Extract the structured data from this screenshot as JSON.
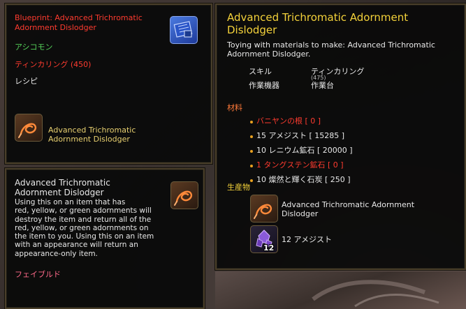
{
  "blueprint_panel": {
    "title_line1": "Blueprint: Advanced Trichromatic",
    "title_line2": "Adornment Dislodger",
    "job": "アシコモン",
    "skill": "ティンカリング (450)",
    "type": "レシピ",
    "result_line1": "Advanced Trichromatic",
    "result_line2": "Adornment Dislodger"
  },
  "item_panel": {
    "name_line1": "Advanced Trichromatic",
    "name_line2": "Adornment Dislodger",
    "description_lines": [
      "Using this on an item that has",
      "red, yellow, or green adornments will",
      "destroy the item and return all of the",
      "red, yellow, or green adornments on",
      "the item to you.  Using this on an item",
      " with an appearance will return an",
      "appearance-only item."
    ],
    "flag": "フェイブルド"
  },
  "recipe_panel": {
    "title_line1": "Advanced Trichromatic Adornment",
    "title_line2": "Dislodger",
    "subtitle_line1": "Toying with materials to make: Advanced Trichromatic",
    "subtitle_line2": "Adornment Dislodger.",
    "skill_label": "スキル",
    "skill_value": "ティンカリング",
    "skill_level": "(475)",
    "device_label": "作業機器",
    "device_value": "作業台",
    "materials_heading": "材料",
    "materials": [
      {
        "text": "バニヤンの根 [ 0 ]",
        "missing": true
      },
      {
        "text": "15 アメジスト [ 15285 ]",
        "missing": false
      },
      {
        "text": "10 レニウム鉱石 [ 20000 ]",
        "missing": false
      },
      {
        "text": "1 タングステン鉱石 [ 0 ]",
        "missing": true
      },
      {
        "text": "10 燦然と輝く石炭 [ 250 ]",
        "missing": false
      }
    ],
    "products_heading": "生産物",
    "product1_line1": "Advanced Trichromatic Adornment",
    "product1_line2": "Dislodger",
    "product2": "12 アメジスト",
    "product2_count": "12"
  },
  "colors": {
    "title_red": "#ff3b2f",
    "job_green": "#56d35a",
    "heading_gold": "#f4d23a",
    "material_missing": "#ff3b2f",
    "bullet": "#e8a020"
  },
  "icons": {
    "blueprint": "blueprint-icon",
    "dislodger": "dislodger-icon",
    "amethyst": "amethyst-gem-icon"
  }
}
